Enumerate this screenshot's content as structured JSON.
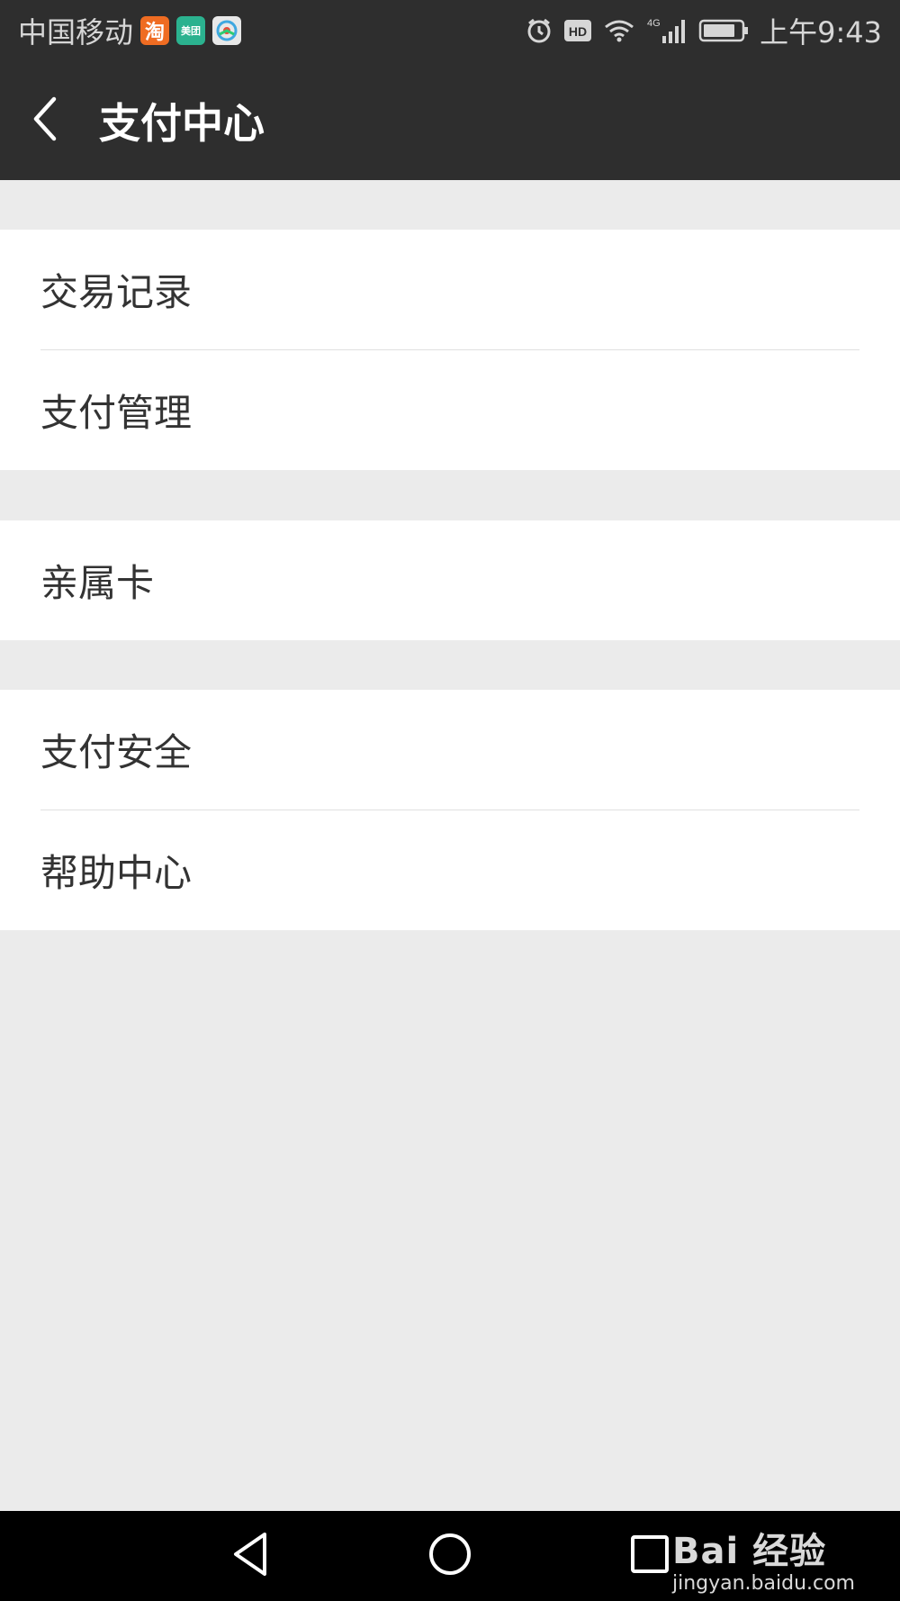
{
  "status_bar": {
    "carrier": "中国移动",
    "app_badges": [
      "淘",
      "美团",
      ""
    ],
    "icons": [
      "alarm-icon",
      "hd-icon",
      "wifi-icon",
      "4g-signal-icon",
      "battery-icon"
    ],
    "hd_label": "HD",
    "network_label": "4G",
    "time": "上午9:43"
  },
  "header": {
    "title": "支付中心",
    "back_icon": "back-chevron-icon",
    "background": "#2e2e2e"
  },
  "groups": [
    {
      "items": [
        "交易记录",
        "支付管理"
      ]
    },
    {
      "items": [
        "亲属卡"
      ]
    },
    {
      "items": [
        "支付安全",
        "帮助中心"
      ]
    }
  ],
  "nav_bar": {
    "icons": [
      "nav-back-icon",
      "nav-home-icon",
      "nav-recents-icon"
    ]
  },
  "watermark": {
    "brand": "Bai 经验",
    "url": "jingyan.baidu.com"
  }
}
